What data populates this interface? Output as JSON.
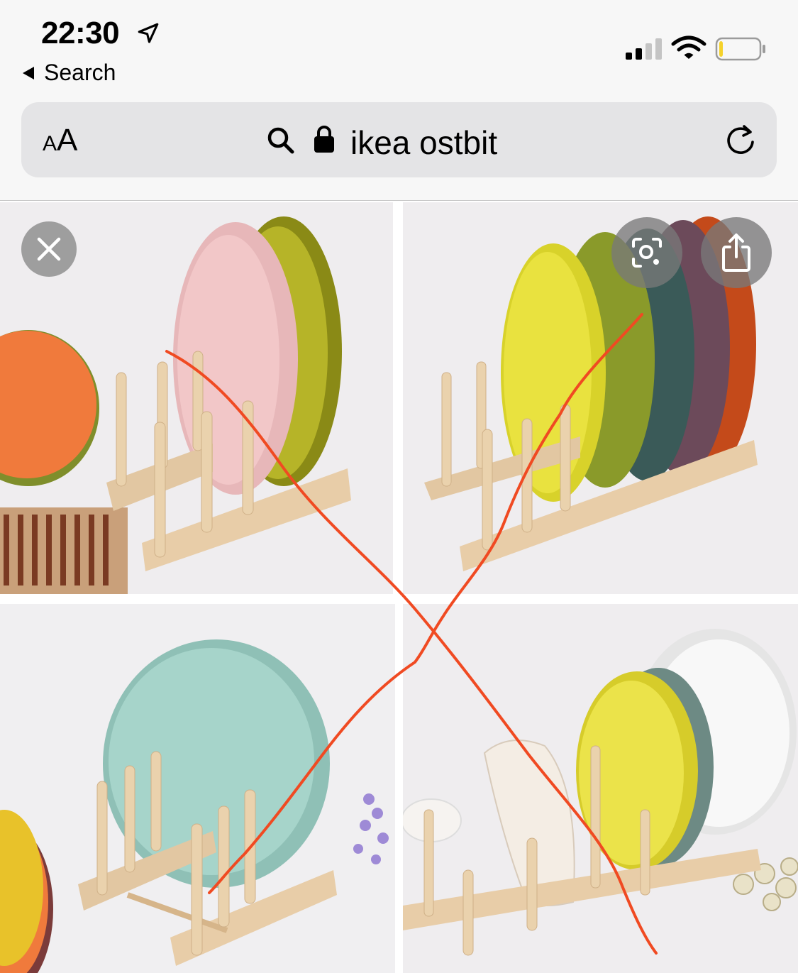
{
  "status_bar": {
    "time": "22:30"
  },
  "nav": {
    "back_label": "Search"
  },
  "url_bar": {
    "text_size_label_small": "A",
    "text_size_label_large": "A",
    "query": "ikea ostbit"
  },
  "icons": {
    "location": "location-arrow-icon",
    "signal": "cellular-signal-icon",
    "wifi": "wifi-icon",
    "battery": "battery-low-icon",
    "search": "search-icon",
    "lock": "lock-icon",
    "reload": "reload-icon",
    "close": "close-icon",
    "visual_lookup": "visual-lookup-icon",
    "share": "share-icon"
  },
  "colors": {
    "scribble": "#f04a22",
    "battery_level": "#f5d22b"
  },
  "battery_level": 0.1,
  "gallery": {
    "images": [
      {
        "subject": "pink-olive-plates-on-wooden-rack"
      },
      {
        "subject": "five-colored-plates-on-long-wooden-rack"
      },
      {
        "subject": "teal-plate-on-wooden-rack"
      },
      {
        "subject": "yellow-white-plates-and-bowl-on-wooden-rack"
      }
    ]
  }
}
